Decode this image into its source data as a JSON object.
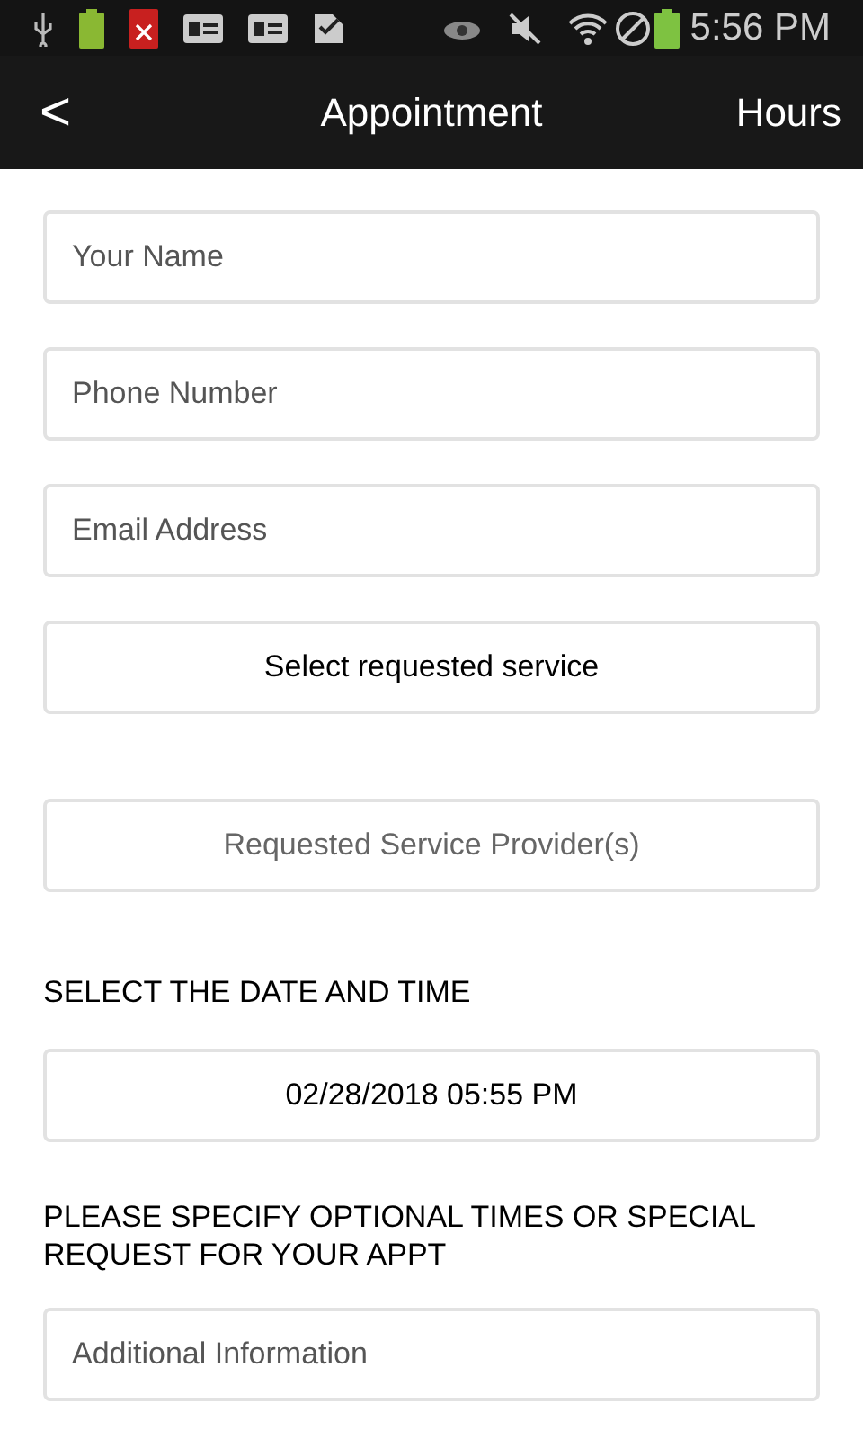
{
  "status_bar": {
    "time": "5:56 PM"
  },
  "header": {
    "back": "<",
    "title": "Appointment",
    "action": "Hours"
  },
  "form": [
    {
      "kind": "input",
      "placeholder": "Your Name"
    },
    {
      "kind": "input",
      "placeholder": "Phone Number"
    },
    {
      "kind": "input",
      "placeholder": "Email Address"
    },
    {
      "kind": "select",
      "text": "Select requested service",
      "disabled": false
    },
    {
      "kind": "select",
      "text": "Requested Service Provider(s)",
      "disabled": true
    },
    {
      "kind": "label",
      "text": "SELECT THE DATE AND TIME"
    },
    {
      "kind": "select",
      "text": "02/28/2018 05:55 PM",
      "disabled": false
    },
    {
      "kind": "label",
      "text": "PLEASE SPECIFY OPTIONAL TIMES OR SPECIAL REQUEST FOR YOUR APPT"
    },
    {
      "kind": "input",
      "placeholder": "Additional Information"
    }
  ]
}
